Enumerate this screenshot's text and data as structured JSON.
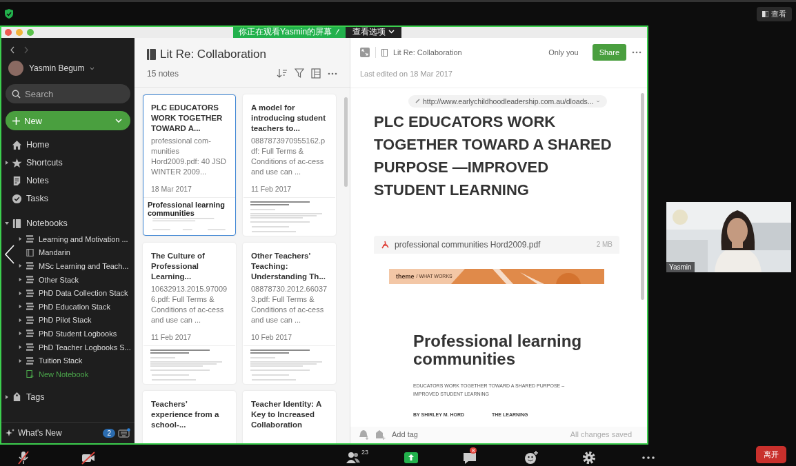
{
  "meeting": {
    "view_button": "查看",
    "banner": "你正在观看Yasmin的屏幕",
    "view_options": "查看选项"
  },
  "sidebar": {
    "user": "Yasmin Begum",
    "search_placeholder": "Search",
    "new_button": "New",
    "items": [
      {
        "label": "Home",
        "kind": "home"
      },
      {
        "label": "Shortcuts",
        "kind": "star",
        "expanded": false
      },
      {
        "label": "Notes",
        "kind": "notes"
      },
      {
        "label": "Tasks",
        "kind": "tasks"
      },
      {
        "label": "Notebooks",
        "kind": "notebooks",
        "expanded": true,
        "children": [
          {
            "label": "Learning and Motivation ...",
            "kind": "stack"
          },
          {
            "label": "Mandarin",
            "kind": "notebook"
          },
          {
            "label": "MSc Learning and Teach...",
            "kind": "stack"
          },
          {
            "label": "Other Stack",
            "kind": "stack"
          },
          {
            "label": "PhD Data Collection Stack",
            "kind": "stack"
          },
          {
            "label": "PhD Education Stack",
            "kind": "stack"
          },
          {
            "label": "PhD Pilot Stack",
            "kind": "stack"
          },
          {
            "label": "PhD Student Logbooks",
            "kind": "stack"
          },
          {
            "label": "PhD Teacher Logbooks S...",
            "kind": "stack"
          },
          {
            "label": "Tuition Stack",
            "kind": "stack"
          },
          {
            "label": "New Notebook",
            "kind": "new"
          }
        ]
      },
      {
        "label": "Tags",
        "kind": "tags",
        "expanded": false
      }
    ],
    "whats_new": "What's New",
    "whats_new_count": "2"
  },
  "list": {
    "title": "Lit Re: Collaboration",
    "count": "15 notes",
    "notes": [
      {
        "title": "PLC EDUCATORS WORK TOGETHER TOWARD A...",
        "snippet": "professional com-munities Hord2009.pdf: 40 JSD WINTER 2009...",
        "date": "18 Mar 2017",
        "selected": true,
        "thumb": {
          "kind": "heading",
          "heading": "Professional learning communities"
        }
      },
      {
        "title": "A model for introducing student teachers to...",
        "snippet": "0887873970955162.pdf: Full Terms & Conditions of ac-cess and use can ...",
        "date": "11 Feb 2017",
        "selected": false,
        "thumb": {
          "kind": "lines"
        }
      },
      {
        "title": "The Culture of Professional Learning...",
        "snippet": "10632913.2015.970096.pdf: Full Terms & Conditions of ac-cess and use can ...",
        "date": "11 Feb 2017",
        "selected": false,
        "thumb": {
          "kind": "lines"
        }
      },
      {
        "title": "Other Teachers' Teaching: Understanding Th...",
        "snippet": "08878730.2012.660373.pdf: Full Terms & Conditions of ac-cess and use can ...",
        "date": "10 Feb 2017",
        "selected": false,
        "thumb": {
          "kind": "lines"
        }
      },
      {
        "title": "Teachers’ experience from a school-...",
        "selected": false
      },
      {
        "title": "Teacher Identity: A Key to Increased Collaboration",
        "selected": false
      }
    ]
  },
  "note": {
    "notebook": "Lit Re: Collaboration",
    "visibility": "Only you",
    "share": "Share",
    "last_edited": "Last edited on 18 Mar 2017",
    "url": "http://www.earlychildhoodleadership.com.au/dloads...",
    "title": "PLC EDUCATORS WORK TOGETHER TOWARD A SHARED PURPOSE —IMPROVED STUDENT LEARNING",
    "attachment": {
      "name": "professional communities Hord2009.pdf",
      "size": "2 MB",
      "banner_main": "theme",
      "banner_sub": "/ WHAT WORKS",
      "heading": "Professional learning communities",
      "subheading": "EDUCATORS WORK TOGETHER TOWARD A SHARED PURPOSE – IMPROVED STUDENT LEARNING",
      "byline": "BY SHIRLEY M. HORD",
      "column_head": "THE LEARNING"
    },
    "add_tag": "Add tag",
    "status": "All changes saved"
  },
  "video": {
    "name": "Yasmin"
  },
  "toolbar": [
    {
      "kind": "mic"
    },
    {
      "kind": "video"
    },
    {
      "kind": "participants",
      "count": "23"
    },
    {
      "kind": "share"
    },
    {
      "kind": "chat",
      "badge": "8"
    },
    {
      "kind": "reactions"
    },
    {
      "kind": "settings"
    },
    {
      "kind": "more"
    }
  ],
  "leave": "离开"
}
